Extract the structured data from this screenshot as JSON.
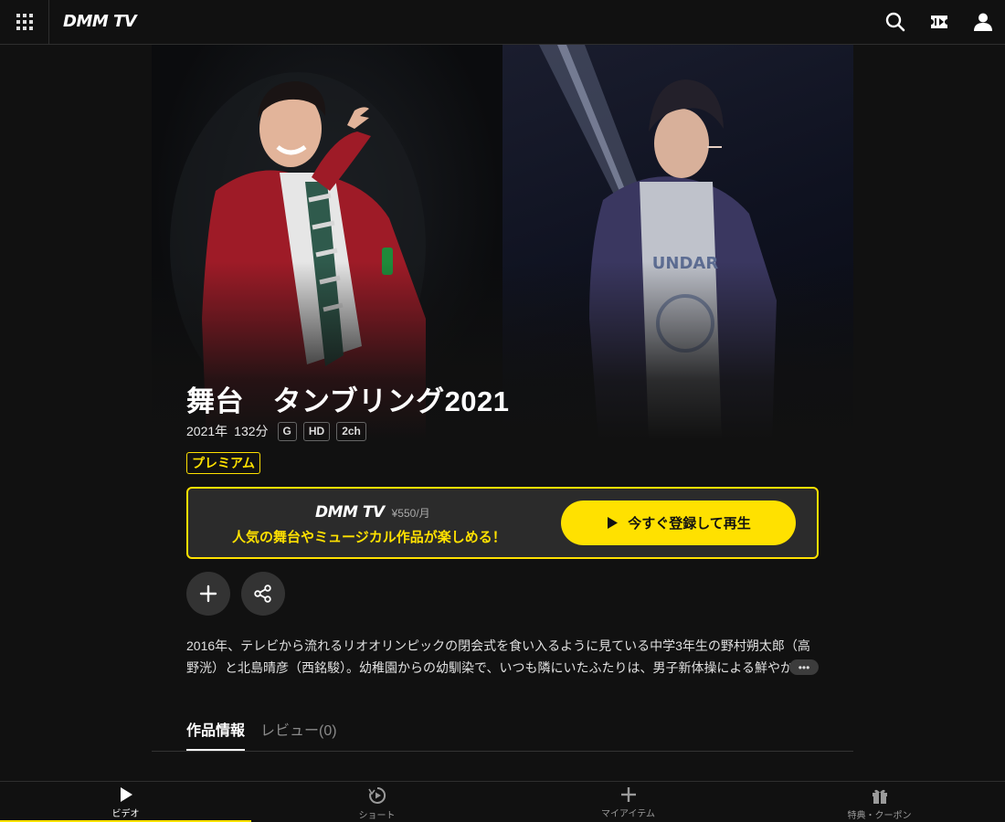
{
  "header": {
    "logo": "DMM TV"
  },
  "work": {
    "title": "舞台　タンブリング2021",
    "year": "2021年",
    "duration": "132分",
    "rating": "G",
    "quality": "HD",
    "audio": "2ch",
    "premium_badge": "プレミアム"
  },
  "promo": {
    "logo": "DMM TV",
    "price": "¥550/月",
    "text": "人気の舞台やミュージカル作品が楽しめる！",
    "cta_label": "今すぐ登録して再生"
  },
  "description": {
    "text": "2016年、テレビから流れるリオオリンピックの閉会式を食い入るように見ている中学3年生の野村朔太郎（高野洸）と北島晴彦（西銘駿）。幼稚園からの幼馴染で、いつも隣にいたふたりは、男子新体操による鮮やかな",
    "more": "•••"
  },
  "tabs": [
    {
      "label": "作品情報"
    },
    {
      "label": "レビュー(0)"
    }
  ],
  "bottom_nav": [
    {
      "label": "ビデオ"
    },
    {
      "label": "ショート"
    },
    {
      "label": "マイアイテム"
    },
    {
      "label": "特典・クーポン"
    }
  ],
  "colors": {
    "accent": "#ffe100",
    "background": "#111111"
  }
}
